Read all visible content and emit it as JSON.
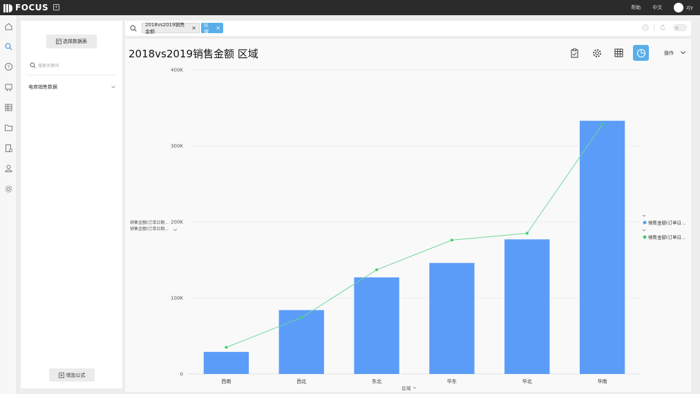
{
  "app": {
    "logo_text": "FOCUS",
    "nav_help": "帮助",
    "nav_lang": "中文",
    "user_name": "zjy"
  },
  "rail": {
    "icons": [
      "home-icon",
      "search-icon",
      "help-icon",
      "board-icon",
      "table-icon",
      "folder-icon",
      "report-icon",
      "user-icon",
      "gear-icon"
    ],
    "active_index": 1
  },
  "panel": {
    "select_table_label": "选择数据表",
    "search_placeholder": "搜索关键词",
    "dataset_label": "电商销售数据",
    "add_formula_label": "增加公式"
  },
  "search": {
    "chips": [
      {
        "label": "2018vs2019销售金额"
      },
      {
        "label": "区域"
      }
    ]
  },
  "main": {
    "title": "2018vs2019销售金额 区域",
    "ops_label": "操作"
  },
  "chart_data": {
    "type": "bar",
    "categories": [
      "西南",
      "西北",
      "东北",
      "华东",
      "华北",
      "华南"
    ],
    "series": [
      {
        "name": "销售金额(订单日...",
        "type": "bar",
        "color": "#5b9cf8",
        "values": [
          29000,
          84000,
          127000,
          146000,
          177000,
          333000
        ]
      },
      {
        "name": "销售金额(订单日...",
        "type": "line",
        "color": "#3ecf6f",
        "values": [
          35000,
          74000,
          137000,
          176000,
          185000,
          328000
        ]
      }
    ],
    "y_ticks": [
      "0",
      "100K",
      "200K",
      "300K",
      "400K"
    ],
    "ylim": [
      0,
      400000
    ],
    "ylabel_lines": [
      "销售金额(订单日期...",
      "销售金额(订单日期..."
    ],
    "xlabel": "区域",
    "legend": [
      {
        "label": "销售金额(订单日...",
        "color": "#5b9cf8"
      },
      {
        "label": "销售金额(订单日...",
        "color": "#3ecf6f"
      }
    ],
    "legend_position": "right",
    "grid": true
  }
}
